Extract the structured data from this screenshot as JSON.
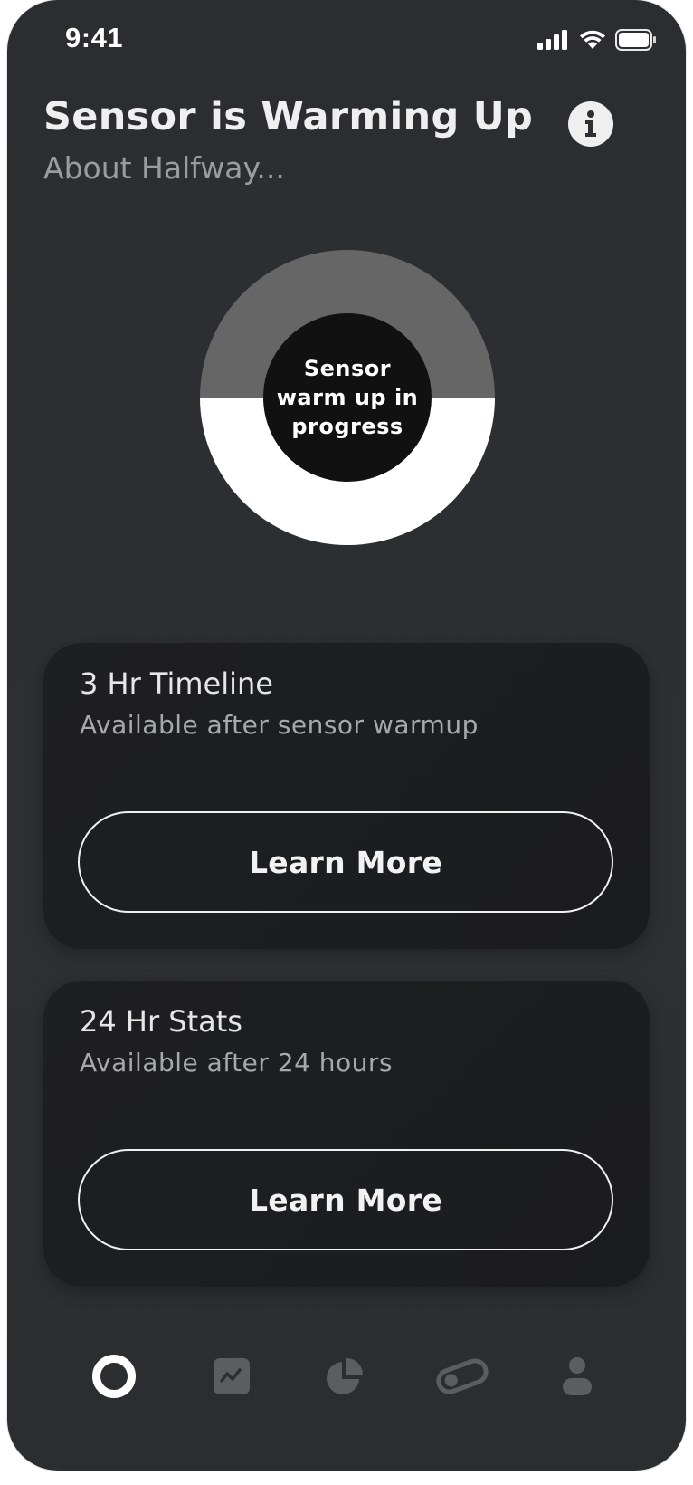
{
  "status_bar": {
    "time": "9:41",
    "icons": [
      "signal-icon",
      "wifi-icon",
      "battery-icon"
    ]
  },
  "header": {
    "title": "Sensor is Warming Up",
    "subtitle": "About Halfway...",
    "info_icon": "info-icon"
  },
  "warmup": {
    "center_label": "Sensor warm up in progress",
    "progress": 0.5
  },
  "cards": [
    {
      "title": "3 Hr Timeline",
      "subtitle": "Available after sensor warmup",
      "button_label": "Learn More"
    },
    {
      "title": "24 Hr Stats",
      "subtitle": "Available after 24 hours",
      "button_label": "Learn More"
    }
  ],
  "bottom_nav": {
    "items": [
      {
        "icon": "home-ring-icon",
        "active": true
      },
      {
        "icon": "trend-chart-icon",
        "active": false
      },
      {
        "icon": "pie-chart-icon",
        "active": false
      },
      {
        "icon": "sensor-toggle-icon",
        "active": false
      },
      {
        "icon": "profile-icon",
        "active": false
      }
    ]
  },
  "colors": {
    "background": "#2d2f32",
    "card": "#1d1e21",
    "ring_remaining": "#666666",
    "ring_filled": "#ffffff",
    "ring_center": "#111111",
    "text_primary": "#efefef",
    "text_secondary": "#9b9c9e",
    "nav_inactive": "#5c5d60"
  }
}
